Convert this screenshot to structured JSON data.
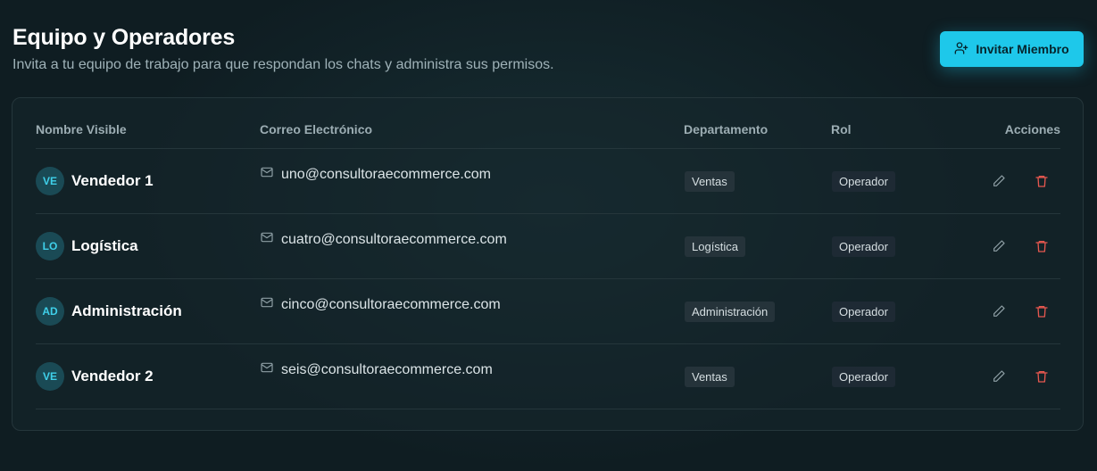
{
  "header": {
    "title": "Equipo y Operadores",
    "subtitle": "Invita a tu equipo de trabajo para que respondan los chats y administra sus permisos.",
    "invite_label": "Invitar Miembro"
  },
  "table": {
    "columns": {
      "name": "Nombre Visible",
      "email": "Correo Electrónico",
      "department": "Departamento",
      "role": "Rol",
      "actions": "Acciones"
    },
    "rows": [
      {
        "initials": "VE",
        "name": "Vendedor 1",
        "email": "uno@consultoraecommerce.com",
        "department": "Ventas",
        "role": "Operador"
      },
      {
        "initials": "LO",
        "name": "Logística",
        "email": "cuatro@consultoraecommerce.com",
        "department": "Logística",
        "role": "Operador"
      },
      {
        "initials": "AD",
        "name": "Administración",
        "email": "cinco@consultoraecommerce.com",
        "department": "Administración",
        "role": "Operador"
      },
      {
        "initials": "VE",
        "name": "Vendedor 2",
        "email": "seis@consultoraecommerce.com",
        "department": "Ventas",
        "role": "Operador"
      }
    ]
  },
  "icons": {
    "invite": "user-plus-icon",
    "email": "mail-icon",
    "edit": "pencil-icon",
    "delete": "trash-icon"
  },
  "colors": {
    "accent": "#1ec8ea",
    "delete": "#e5574f",
    "background": "#0f1d22"
  }
}
